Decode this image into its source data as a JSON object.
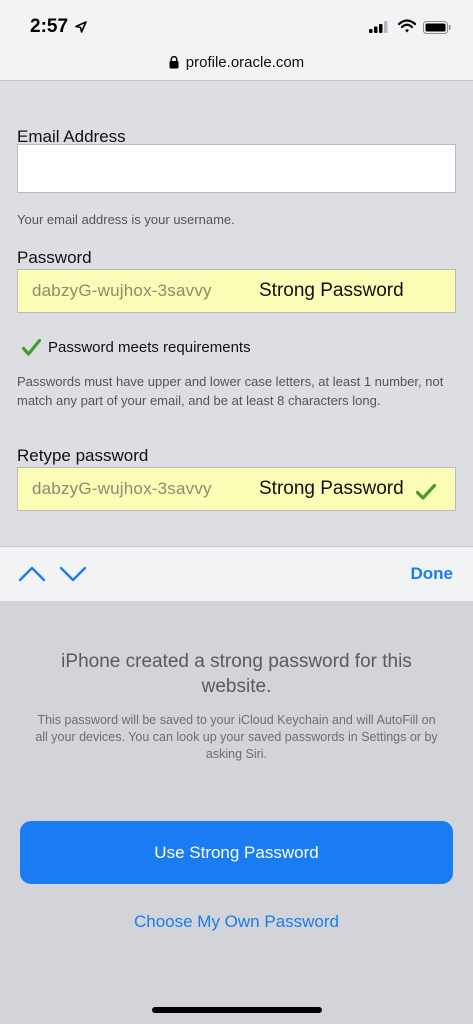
{
  "status_bar": {
    "time": "2:57"
  },
  "browser": {
    "url": "profile.oracle.com"
  },
  "form": {
    "email_label": "Email Address",
    "email_value": "",
    "email_hint": "Your email address is your username.",
    "password_label": "Password",
    "password_value": "dabzyG-wujhox-3savvy",
    "password_strength_label": "Strong Password",
    "requirements_met_text": "Password meets requirements",
    "password_rules_hint": "Passwords must have upper and lower case letters, at least 1 number, not match any part of your email, and be at least 8 characters long.",
    "retype_label": "Retype password",
    "retype_value": "dabzyG-wujhox-3savvy",
    "retype_strength_label": "Strong Password"
  },
  "accessory_bar": {
    "done_label": "Done"
  },
  "password_sheet": {
    "title": "iPhone created a strong password for this website.",
    "body": "This password will be saved to your iCloud Keychain and will AutoFill on all your devices. You can look up your saved passwords in Settings or by asking Siri.",
    "use_button_label": "Use Strong Password",
    "choose_own_label": "Choose My Own Password"
  },
  "colors": {
    "accent_blue": "#1a7cf2",
    "autofill_yellow": "#fbfcb6",
    "check_green": "#4a9a2a"
  },
  "icons": [
    "location-arrow-icon",
    "signal-bars-icon",
    "wifi-icon",
    "battery-icon",
    "lock-icon",
    "checkmark-icon",
    "chevron-up-icon",
    "chevron-down-icon"
  ]
}
